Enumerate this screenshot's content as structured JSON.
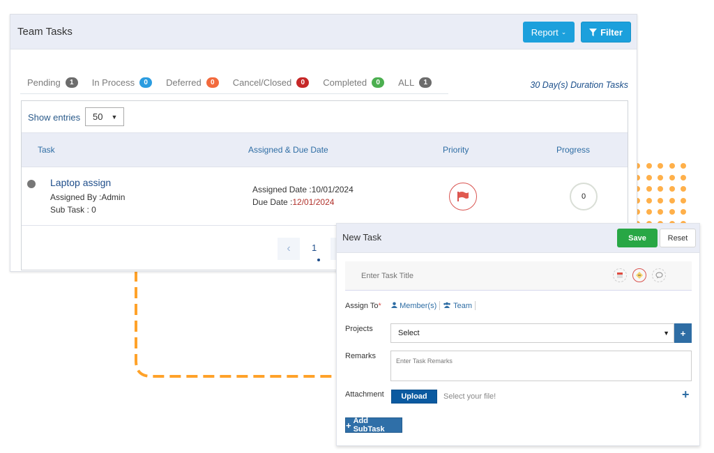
{
  "team_tasks": {
    "title": "Team Tasks",
    "report_label": "Report",
    "filter_label": "Filter",
    "tabs": [
      {
        "label": "Pending",
        "count": "1",
        "color": "#6c6c6c"
      },
      {
        "label": "In Process",
        "count": "0",
        "color": "#2b9ce0"
      },
      {
        "label": "Deferred",
        "count": "0",
        "color": "#f26a3d"
      },
      {
        "label": "Cancel/Closed",
        "count": "0",
        "color": "#c62828"
      },
      {
        "label": "Completed",
        "count": "0",
        "color": "#4caf50"
      },
      {
        "label": "ALL",
        "count": "1",
        "color": "#6c6c6c"
      }
    ],
    "duration_label": "30 Day(s) Duration Tasks",
    "show_entries_label": "Show entries",
    "entries_value": "50",
    "columns": [
      "Task",
      "Assigned & Due Date",
      "Priority",
      "Progress"
    ],
    "rows": [
      {
        "task_name": "Laptop assign",
        "assigned_by": "Assigned By :Admin",
        "sub_task": "Sub Task : 0",
        "assigned_date_label": "Assigned Date :",
        "assigned_date": "10/01/2024",
        "due_date_label": "Due Date :",
        "due_date": "12/01/2024",
        "priority_icon": "flag-icon",
        "progress": "0"
      }
    ],
    "pagination": {
      "current_page": "1",
      "prev_icon": "‹"
    }
  },
  "new_task": {
    "title": "New Task",
    "save_label": "Save",
    "reset_label": "Reset",
    "title_placeholder": "Enter Task Title",
    "assign_to_label": "Assign To",
    "required_mark": "*",
    "members_label": "Member(s)",
    "team_label": "Team",
    "projects_label": "Projects",
    "projects_value": "Select",
    "remarks_label": "Remarks",
    "remarks_placeholder": "Enter Task Remarks",
    "attachment_label": "Attachment",
    "upload_label": "Upload",
    "file_hint": "Select your file!",
    "add_subtask_label": "Add SubTask"
  },
  "colors": {
    "accent_blue": "#1ca0dc",
    "save_green": "#28a745",
    "dark_blue": "#2e6da4",
    "decor_orange": "#ffa229"
  }
}
